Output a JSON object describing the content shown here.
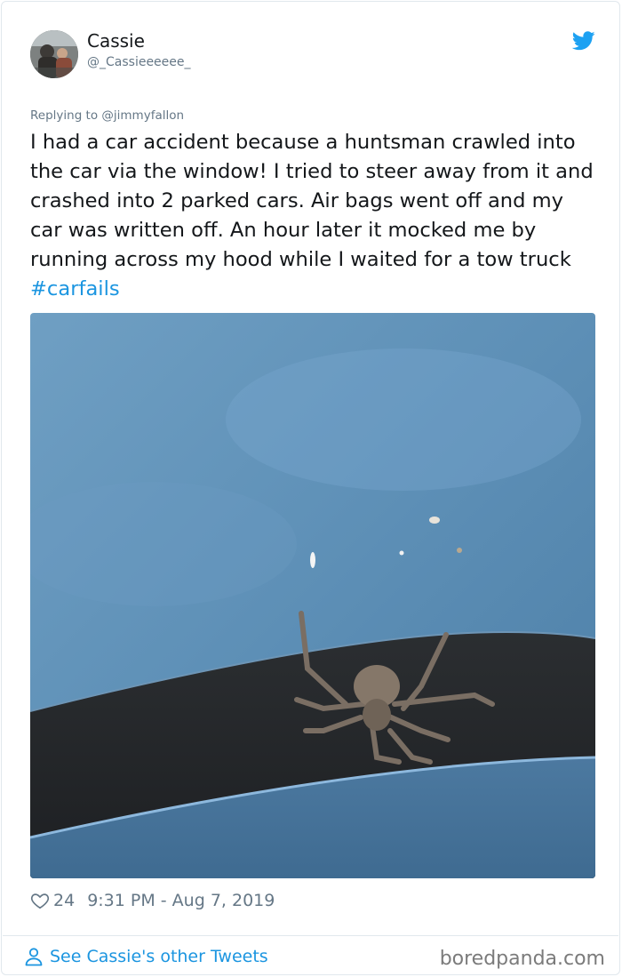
{
  "author": {
    "display_name": "Cassie",
    "handle": "@_Cassieeeeee_"
  },
  "reply_to": "Replying to @jimmyfallon",
  "tweet": {
    "text": "I had a car accident because a huntsman crawled into the car via the window! I tried to steer away from it and crashed into 2 parked cars. Air bags went off and my car was written off. An hour later it mocked me by running across my hood while I waited for a tow truck ",
    "hashtag": "#carfails"
  },
  "meta": {
    "likes": "24",
    "timestamp": "9:31 PM - Aug 7, 2019"
  },
  "footer": {
    "see_more": "See Cassie's other Tweets",
    "watermark": "boredpanda.com"
  },
  "icons": {
    "brand": "twitter-bird-icon",
    "like": "heart-outline-icon",
    "profile": "person-outline-icon"
  },
  "colors": {
    "link": "#1b95e0",
    "secondary_text": "#657786",
    "border": "#e1e8ed"
  }
}
